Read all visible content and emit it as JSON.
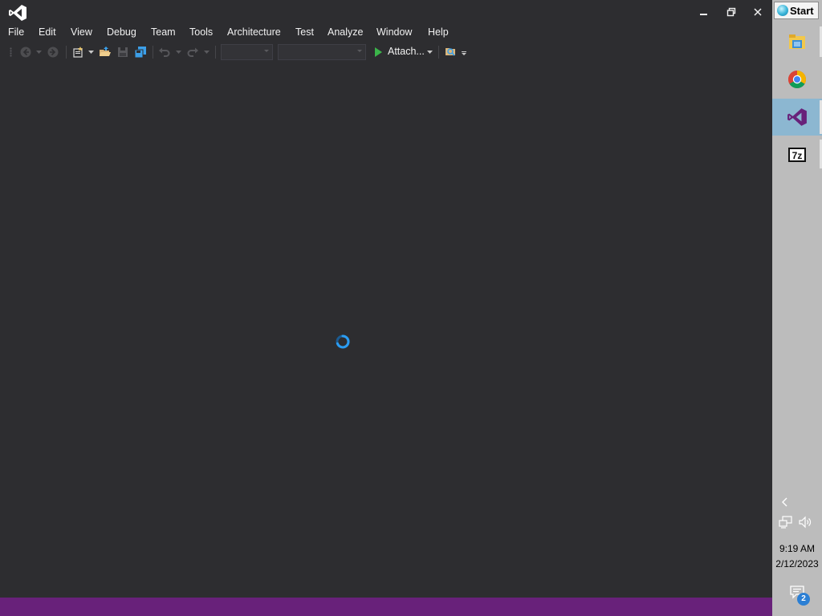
{
  "menu": {
    "items": [
      "File",
      "Edit",
      "View",
      "Debug",
      "Team",
      "Tools",
      "Architecture",
      "Test",
      "Analyze",
      "Window",
      "Help"
    ]
  },
  "toolbar": {
    "attach_label": "Attach...",
    "solution_config_value": "",
    "solution_platform_value": ""
  },
  "taskbar": {
    "start_label": "Start",
    "apps": [
      "file-explorer",
      "google-chrome",
      "visual-studio",
      "7-zip"
    ],
    "active_app": "visual-studio",
    "clock_time": "9:19 AM",
    "clock_date": "2/12/2023",
    "notification_count": "2"
  },
  "colors": {
    "window_background": "#2d2d30",
    "status_bar": "#68217a",
    "accent_blue": "#2b9cf2",
    "taskbar": "#bcbcbc",
    "active_task": "#8cb7d1"
  }
}
